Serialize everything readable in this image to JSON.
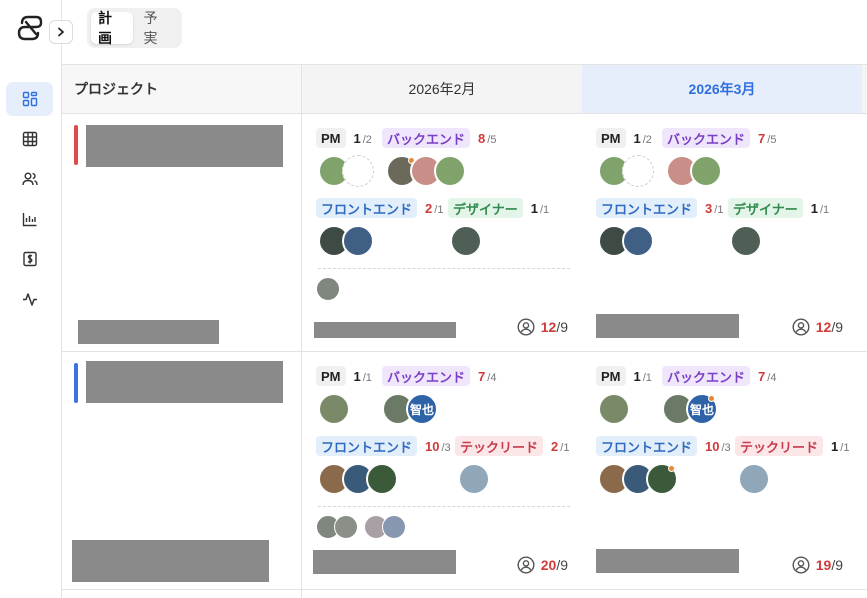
{
  "app": {
    "toggle": {
      "left": "計画",
      "right": "予実",
      "active": "計画"
    }
  },
  "table": {
    "project_header": "プロジェクト",
    "months": [
      "2026年2月",
      "2026年3月"
    ],
    "rows": [
      {
        "accent_color": "#e04a4a",
        "cells": [
          {
            "roles": [
              {
                "name": "PM",
                "assigned": "1",
                "required": "2"
              },
              {
                "name": "バックエンド",
                "assigned": "8",
                "required": "5"
              },
              {
                "name": "フロントエンド",
                "assigned": "2",
                "required": "1"
              },
              {
                "name": "デザイナー",
                "assigned": "1",
                "required": "1"
              }
            ],
            "total": {
              "assigned": "12",
              "required": "9"
            }
          },
          {
            "roles": [
              {
                "name": "PM",
                "assigned": "1",
                "required": "2"
              },
              {
                "name": "バックエンド",
                "assigned": "7",
                "required": "5"
              },
              {
                "name": "フロントエンド",
                "assigned": "3",
                "required": "1"
              },
              {
                "name": "デザイナー",
                "assigned": "1",
                "required": "1"
              }
            ],
            "total": {
              "assigned": "12",
              "required": "9"
            }
          }
        ]
      },
      {
        "accent_color": "#3f72e0",
        "cells": [
          {
            "roles": [
              {
                "name": "PM",
                "assigned": "1",
                "required": "1"
              },
              {
                "name": "バックエンド",
                "assigned": "7",
                "required": "4"
              },
              {
                "name": "フロントエンド",
                "assigned": "10",
                "required": "3"
              },
              {
                "name": "テックリード",
                "assigned": "2",
                "required": "1"
              }
            ],
            "avatar_initials": "智也",
            "total": {
              "assigned": "20",
              "required": "9"
            }
          },
          {
            "roles": [
              {
                "name": "PM",
                "assigned": "1",
                "required": "1"
              },
              {
                "name": "バックエンド",
                "assigned": "7",
                "required": "4"
              },
              {
                "name": "フロントエンド",
                "assigned": "10",
                "required": "3"
              },
              {
                "name": "テックリード",
                "assigned": "1",
                "required": "1"
              }
            ],
            "avatar_initials": "智也",
            "total": {
              "assigned": "19",
              "required": "9"
            }
          }
        ]
      }
    ]
  },
  "icons": {
    "logo": "app-logo-icon",
    "expand": "chevron-right-icon",
    "nav": [
      "dashboard-icon",
      "grid-icon",
      "users-icon",
      "chart-icon",
      "dollar-icon",
      "activity-icon"
    ],
    "total": "user-circle-icon"
  },
  "colors": {
    "pm_bg": "#f0f0f0",
    "backend_bg": "#efe6fb",
    "backend_fg": "#7a3fc8",
    "frontend_bg": "#e3eefb",
    "frontend_fg": "#2f6bc0",
    "designer_bg": "#e3f4e8",
    "designer_fg": "#2f8a4c",
    "techlead_bg": "#fbe6e8",
    "techlead_fg": "#c83a4c",
    "over": "#d13a3a",
    "accent_header": "#2f6fe0"
  }
}
